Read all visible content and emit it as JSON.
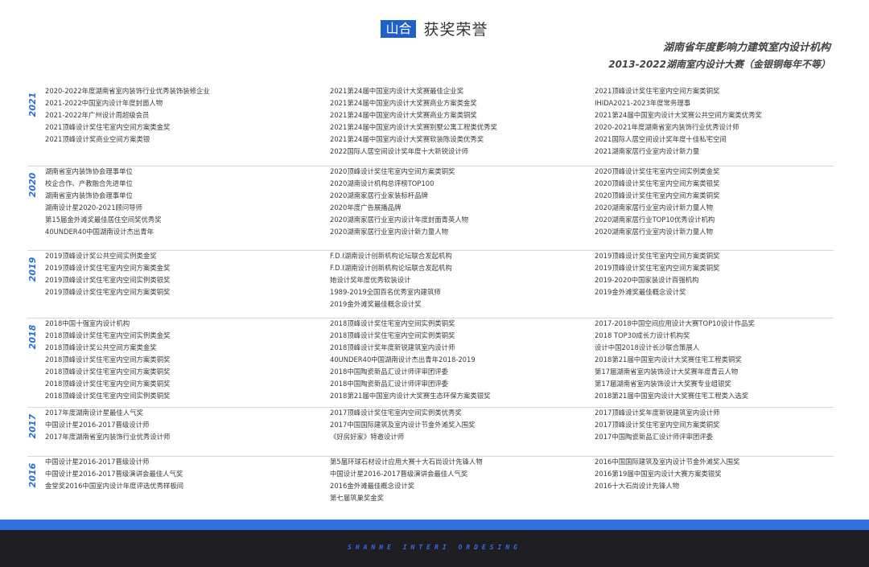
{
  "header": {
    "brand": "山合",
    "title": "获奖荣誉",
    "subtitle1": "湖南省年度影响力建筑室内设计机构",
    "subtitle2": "2013-2022湖南室内设计大赛（金银铜每年不等）"
  },
  "sections": [
    {
      "year": "2021",
      "col1": [
        "2020-2022年度湖南省室内装饰行业优秀装饰装修企业",
        "2021-2022中国室内设计年度封面人物",
        "2021-2022年广州设计周超级会员",
        "2021顶峰设计奖住宅室内空间方案类金奖",
        "2021顶峰设计奖商业空间方案类银"
      ],
      "col2": [
        "2021第24届中国室内设计大奖赛最佳企业奖",
        "2021第24届中国室内设计大奖赛商业方案类金奖",
        "2021第24届中国室内设计大奖赛商业方案类铜奖",
        "2021第24届中国室内设计大奖赛别墅公寓工程类优秀奖",
        "2021第24届中国室内设计大奖赛软装陈设类优秀奖",
        "2022国际人居空间设计奖年度十大新锐设计师"
      ],
      "col3": [
        "2021顶峰设计奖住宅室内空间方案类铜奖",
        "IHIDA2021-2023年度常务理事",
        "2021第24届中国室内设计大奖赛公共空间方案类优秀奖",
        "2020-2021年度湖南省室内装饰行业优秀设计师",
        "2021国际人居空间设计奖年度十佳私宅空间",
        "2021湖南家居行业室内设计新力量"
      ]
    },
    {
      "year": "2020",
      "col1": [
        "湖南省室内装饰协会理事单位",
        "校企合作、产教融合先进单位",
        "湖南省室内装饰协会理事单位",
        "湖南设计星2020-2021顾问导师",
        "第15届金外滩奖最佳居住空间奖优秀奖",
        "40UNDER40中国湖南设计杰出青年"
      ],
      "col2": [
        "2020顶峰设计奖住宅室内空间方案类铜奖",
        "2020湖南设计机构总评榜TOP100",
        "2020湖南家居行业家装标杆品牌",
        "2020年度广告展播品牌",
        "2020湖南家居行业室内设计年度封面青英人物",
        "2020湖南家居行业室内设计新力量人物"
      ],
      "col3": [
        "2020顶峰设计奖住宅室内空间实例类金奖",
        "2020顶峰设计奖住宅室内空间方案类银奖",
        "2020顶峰设计奖住宅室内空间方案类铜奖",
        "2020湖南家居行业室内设计新力量人物",
        "2020湖南家居行业TOP10优秀设计机构",
        "2020湖南家居行业室内设计新力量人物"
      ]
    },
    {
      "year": "2019",
      "col1": [
        "2019顶峰设计奖公共空间实例类金奖",
        "2019顶峰设计奖住宅室内空间方案类金奖",
        "2019顶峰设计奖住宅室内空间实例类银奖",
        "2019顶峰设计奖住宅室内空间方案类铜奖"
      ],
      "col2": [
        "F.D.I湖南设计创新机构论坛联合发起机构",
        "F.D.I湖南设计创新机构论坛联合发起机构",
        "她设计奖年度优秀软装设计",
        "1989-2019全国百名优秀室内建筑师",
        "2019金外滩奖最佳概念设计奖"
      ],
      "col3": [
        "2019顶峰设计奖住宅室内空间方案类铜奖",
        "2019顶峰设计奖住宅室内空间方案类铜奖",
        "2019-2020中国家装设计百强机构",
        "2019金外滩奖最佳概念设计奖"
      ]
    },
    {
      "year": "2018",
      "col1": [
        "2018中国十强室内设计机构",
        "2018顶峰设计奖住宅室内空间实例类金奖",
        "2018顶峰设计奖公共空间方案类金奖",
        "2018顶峰设计奖住宅室内空间方案类铜奖",
        "2018顶峰设计奖住宅室内空间方案类铜奖",
        "2018顶峰设计奖住宅室内空间方案类铜奖",
        "2018顶峰设计奖住宅室内空间实例类铜奖"
      ],
      "col2": [
        "2018顶峰设计奖住宅室内空间实例类铜奖",
        "2018顶峰设计奖住宅室内空间实例类铜奖",
        "2018顶峰设计奖年度新锐建筑室内设计师",
        "40UNDER40中国湖南设计杰出青年2018-2019",
        "2018中国陶瓷新品汇设计师评审团评委",
        "2018中国陶瓷新品汇设计师评审团评委",
        "2018第21届中国室内设计大奖赛生态环保方案类银奖"
      ],
      "col3": [
        "2017-2018中国空间应用设计大赛TOP10设计作品奖",
        "2018 TOP30成长力设计机构奖",
        "设计中国2018设计长沙联合策展人",
        "2018第21届中国室内设计大奖赛住宅工程类铜奖",
        "第17届湖南省室内装饰设计大奖赛年度青云人物",
        "第17届湖南省室内装饰设计大奖赛专业组银奖",
        "2018第21届中国室内设计大奖赛住宅工程类入选奖"
      ]
    },
    {
      "year": "2017",
      "col1": [
        "2017年度湖南设计星最佳人气奖",
        "中国设计星2016-2017晋级设计师",
        "2017年度湖南省室内装饰行业优秀设计师"
      ],
      "col2": [
        "2017顶峰设计奖住宅室内空间实例类优秀奖",
        "2017中国国际建筑及室内设计节金外滩奖入围奖",
        "《好房好家》特邀设计师"
      ],
      "col3": [
        "2017顶峰设计奖年度新锐建筑室内设计师",
        "2017顶峰设计奖住宅室内空间方案类铜奖",
        "2017中国陶瓷新品汇设计师评审团评委"
      ]
    },
    {
      "year": "2016",
      "col1": [
        "中国设计星2016-2017晋级设计师",
        "中国设计星2016-2017晋级演讲会最佳人气奖",
        "金堂奖2016中国室内设计年度评选优秀样板间"
      ],
      "col2": [
        "第5届环球石材设计应用大赛十大石尚设计先锋人物",
        "中国设计星2016-2017晋级演讲会最佳人气奖",
        "2016金外滩最佳概念设计奖",
        "第七届筑巢奖金奖"
      ],
      "col3": [
        "2016中国国际建筑及室内设计节金外滩奖入围奖",
        "2016第19届中国室内设计大赛方案类银奖",
        "2016十大石尚设计先锋人物"
      ]
    }
  ],
  "footer": {
    "tagline": "SHANHE INTERI ORDESING"
  }
}
